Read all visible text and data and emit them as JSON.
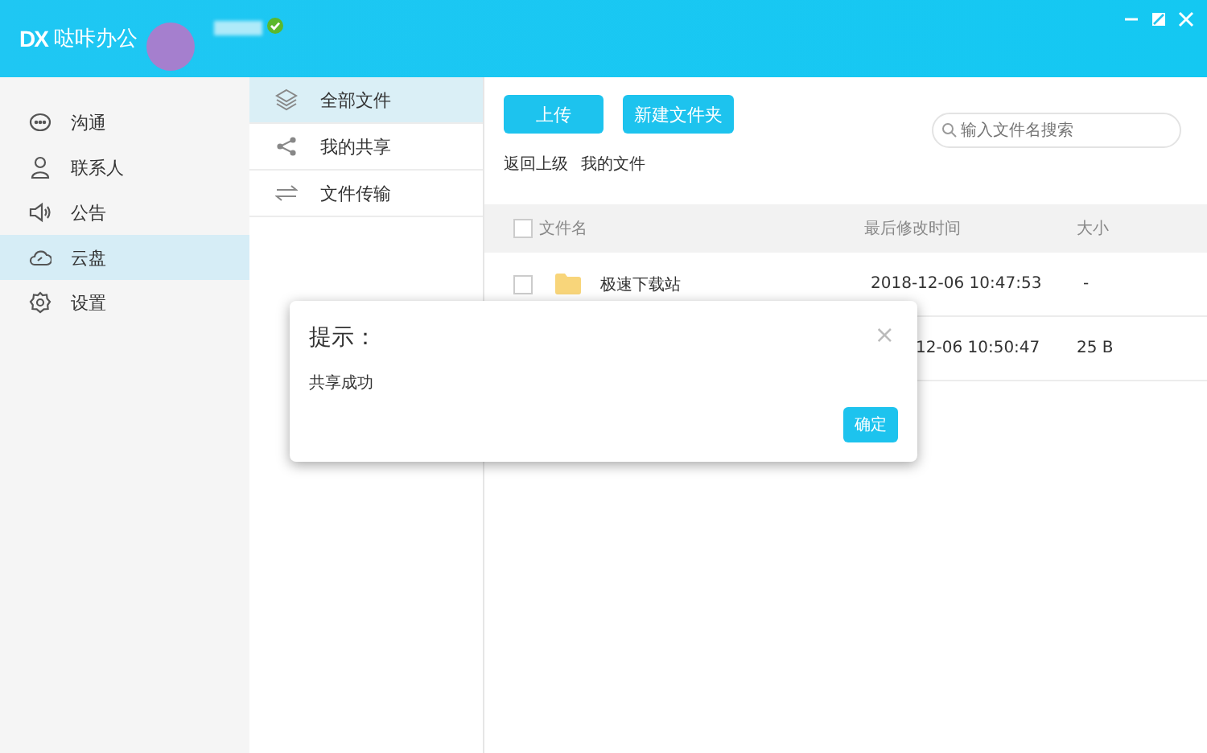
{
  "app": {
    "name": "哒咔办公",
    "logo": "DX",
    "online": true
  },
  "window_controls": [
    {
      "kind": "minimize"
    },
    {
      "kind": "restore"
    },
    {
      "kind": "close"
    }
  ],
  "nav": [
    {
      "label": "沟通",
      "kind": "chat",
      "selected": false
    },
    {
      "label": "联系人",
      "kind": "person",
      "selected": false
    },
    {
      "label": "公告",
      "kind": "speaker",
      "selected": false
    },
    {
      "label": "云盘",
      "kind": "cloud",
      "selected": true
    },
    {
      "label": "设置",
      "kind": "gear",
      "selected": false
    }
  ],
  "subnav": [
    {
      "label": "全部文件",
      "kind": "layers",
      "selected": true
    },
    {
      "label": "我的共享",
      "kind": "share",
      "selected": false
    },
    {
      "label": "文件传输",
      "kind": "transfer",
      "selected": false
    }
  ],
  "toolbar": {
    "buttons": [
      "上传",
      "新建文件夹"
    ],
    "search": {
      "placeholder": "输入文件名搜索"
    }
  },
  "breadcrumb": [
    "返回上级",
    "我的文件"
  ],
  "table": {
    "all_checked": false,
    "columns": [
      "文件名",
      "最后修改时间",
      "大小"
    ],
    "rows": [
      {
        "kind": "folder",
        "checked": false,
        "name": "极速下载站",
        "modified": "2018-12-06 10:47:53",
        "size": "-"
      },
      {
        "kind": "covered",
        "modified": "12-06 10:50:47",
        "size": "25 B"
      }
    ]
  },
  "dialog": {
    "title": "提示：",
    "message": "共享成功",
    "close": "×",
    "button": "确定"
  }
}
